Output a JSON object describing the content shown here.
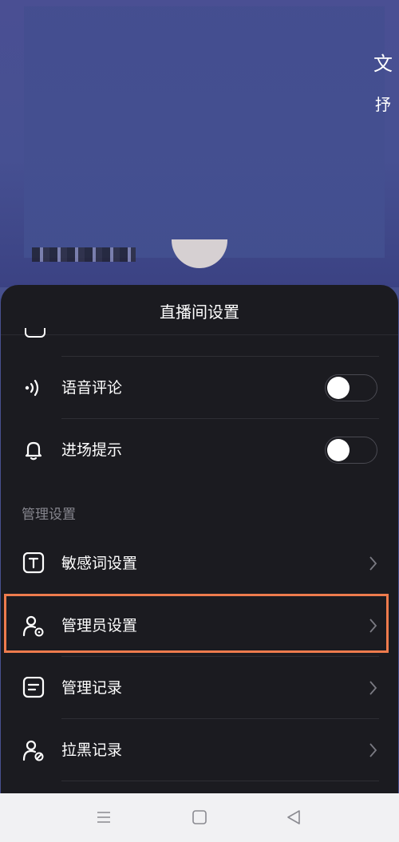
{
  "background": {
    "char_right_top": "文",
    "char_right_mid": "抒"
  },
  "sheet": {
    "title": "直播间设置",
    "rows": [
      {
        "label": "语音评论",
        "icon": "sound-wave-icon",
        "control": "toggle",
        "on": false
      },
      {
        "label": "进场提示",
        "icon": "bell-icon",
        "control": "toggle",
        "on": false
      }
    ],
    "section_header": "管理设置",
    "manage_rows": [
      {
        "label": "敏感词设置",
        "icon": "text-t-icon"
      },
      {
        "label": "管理员设置",
        "icon": "user-gear-icon",
        "highlighted": true
      },
      {
        "label": "管理记录",
        "icon": "document-icon"
      },
      {
        "label": "拉黑记录",
        "icon": "user-block-icon"
      }
    ]
  },
  "colors": {
    "sheet_bg": "#1b1b20",
    "highlight": "#ee7b4d",
    "navbar_bg": "#f1f1f3"
  },
  "navbar": {
    "buttons": [
      "menu-icon",
      "home-square-icon",
      "back-triangle-icon"
    ]
  }
}
